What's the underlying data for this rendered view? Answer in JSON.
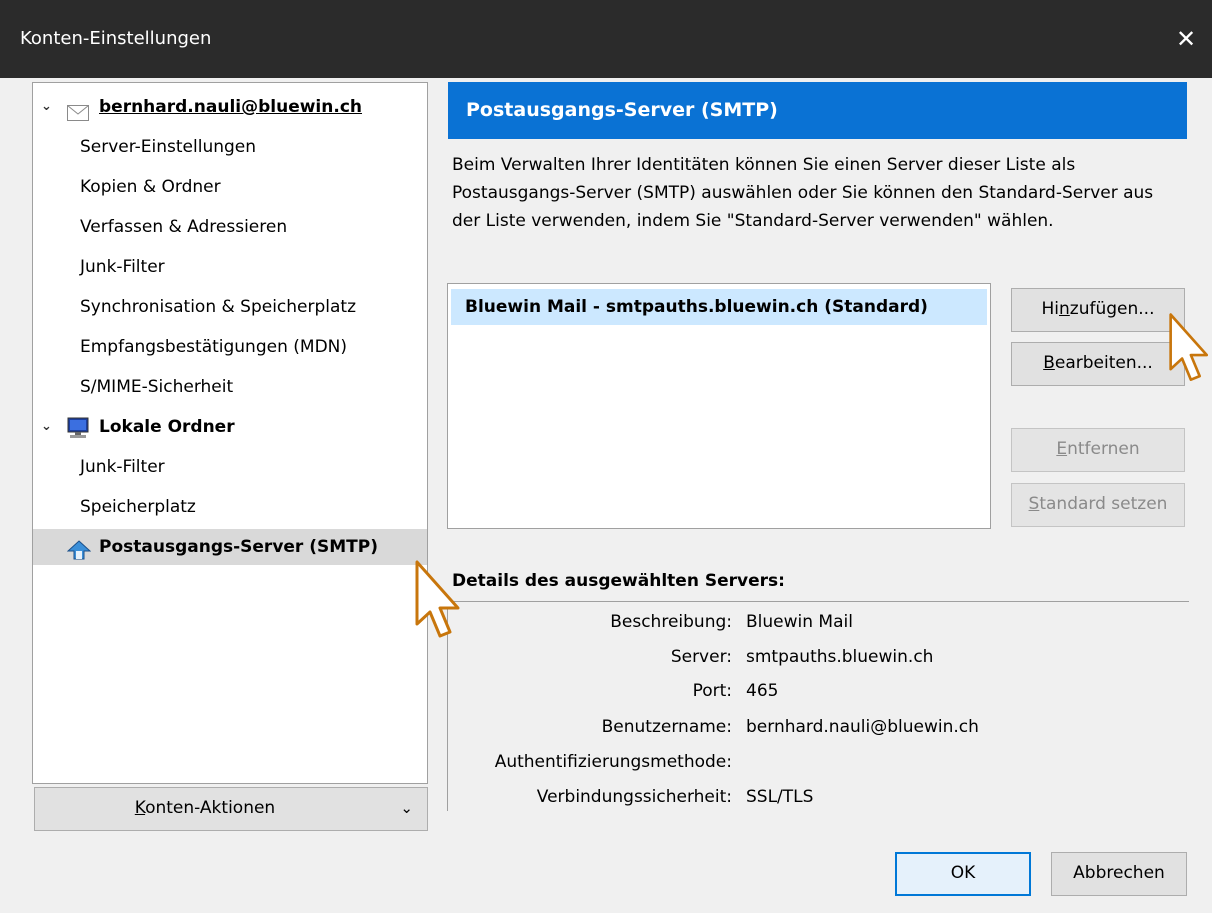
{
  "window": {
    "title": "Konten-Einstellungen",
    "close": "✕"
  },
  "tree": {
    "accounts": [
      {
        "label": "bernhard.nauli@bluewin.ch",
        "icon": "envelope-icon",
        "children": [
          "Server-Einstellungen",
          "Kopien & Ordner",
          "Verfassen & Adressieren",
          "Junk-Filter",
          "Synchronisation & Speicherplatz",
          "Empfangsbestätigungen (MDN)",
          "S/MIME-Sicherheit"
        ]
      },
      {
        "label": "Lokale Ordner",
        "icon": "local-folders-icon",
        "children": [
          "Junk-Filter",
          "Speicherplatz"
        ]
      }
    ],
    "outgoing": {
      "label": "Postausgangs-Server (SMTP)",
      "icon": "outgoing-server-icon",
      "selected": true
    }
  },
  "account_actions": {
    "prefix": "",
    "accel": "K",
    "rest": "onten-Aktionen"
  },
  "panel": {
    "title": "Postausgangs-Server (SMTP)",
    "description": "Beim Verwalten Ihrer Identitäten können Sie einen Server dieser Liste als Postausgangs-Server (SMTP) auswählen oder Sie können den Standard-Server aus der Liste verwenden, indem Sie \"Standard-Server verwenden\" wählen."
  },
  "servers": [
    {
      "label": "Bluewin Mail - smtpauths.bluewin.ch (Standard)",
      "selected": true
    }
  ],
  "buttons": {
    "add": {
      "pre": "Hi",
      "accel": "n",
      "post": "zufügen..."
    },
    "edit": {
      "pre": "",
      "accel": "B",
      "post": "earbeiten..."
    },
    "remove": {
      "pre": "",
      "accel": "E",
      "post": "ntfernen"
    },
    "set_default": {
      "pre": "",
      "accel": "S",
      "post": "tandard setzen"
    },
    "ok": "OK",
    "cancel": "Abbrechen"
  },
  "details": {
    "title": "Details des ausgewählten Servers:",
    "rows": [
      {
        "label": "Beschreibung:",
        "value": "Bluewin Mail"
      },
      {
        "label": "Server:",
        "value": "smtpauths.bluewin.ch"
      },
      {
        "label": "Port:",
        "value": "465"
      },
      {
        "label": "Benutzername:",
        "value": "bernhard.nauli@bluewin.ch"
      },
      {
        "label": "Authentifizierungsmethode:",
        "value": ""
      },
      {
        "label": "Verbindungssicherheit:",
        "value": "SSL/TLS"
      }
    ]
  },
  "colors": {
    "header_bg": "#0a72d4",
    "selection": "#cce8ff",
    "cursor_outline": "#c8760c"
  }
}
